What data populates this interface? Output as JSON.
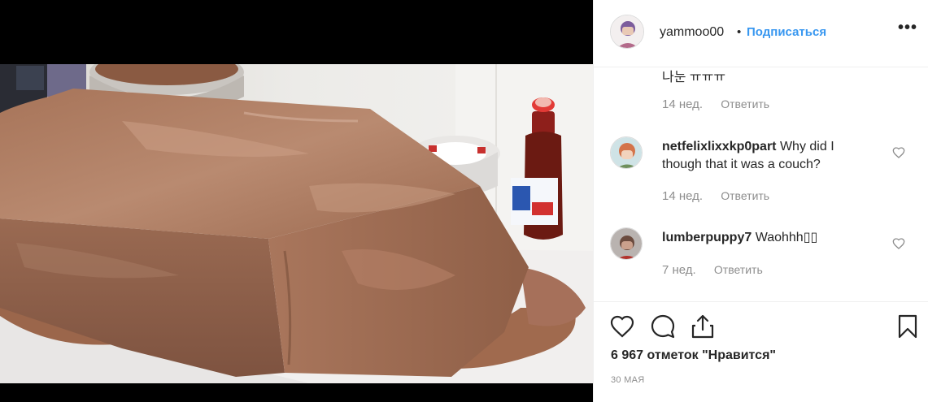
{
  "post": {
    "username": "yammoo00",
    "separator": "•",
    "follow_label": "Подписаться",
    "more_label": "•••",
    "image_description": "melted-chocolate-coated-block-photo"
  },
  "comments": {
    "partial_first": {
      "text": "나눈 ㅠㅠㅠ",
      "time": "14 нед.",
      "reply_label": "Ответить"
    },
    "items": [
      {
        "username": "netfelixlixxkp0part",
        "text": "Why did I though that it was a couch?",
        "time": "14 нед.",
        "reply_label": "Ответить"
      },
      {
        "username": "lumberpuppy7",
        "text": "Waohhh▯▯",
        "time": "7 нед.",
        "reply_label": "Ответить"
      }
    ]
  },
  "actions": {
    "like_icon": "heart-icon",
    "comment_icon": "comment-icon",
    "share_icon": "share-icon",
    "save_icon": "bookmark-icon"
  },
  "likes_text": "6 967 отметок \"Нравится\"",
  "date": "30 МАЯ",
  "colors": {
    "link_blue": "#3897f0",
    "muted_gray": "#8e8e8e",
    "text": "#262626",
    "chocolate": "#a06a4e"
  }
}
